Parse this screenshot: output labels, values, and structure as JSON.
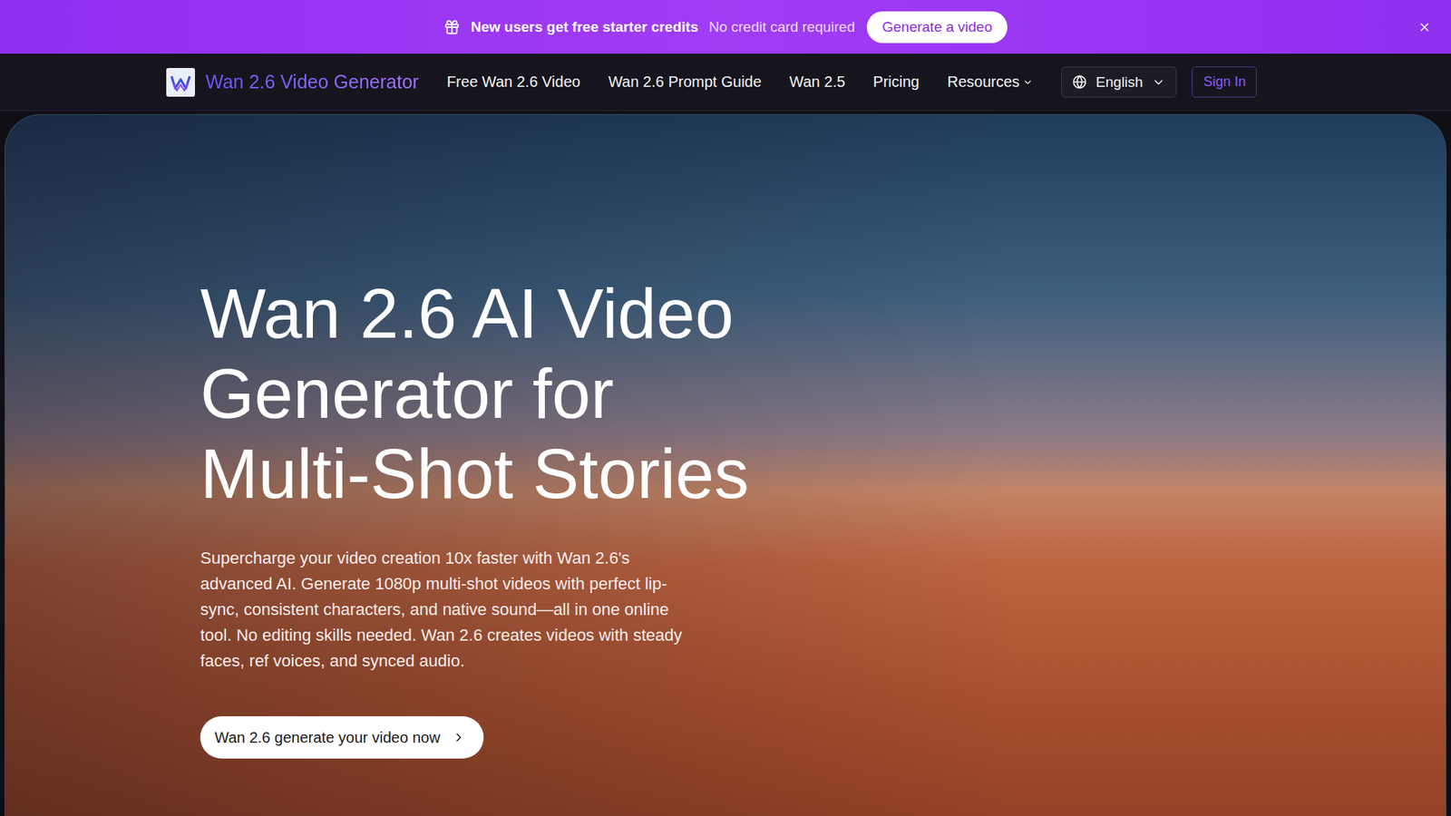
{
  "banner": {
    "title": "New users get free starter credits",
    "subtitle": "No credit card required",
    "button": "Generate a video"
  },
  "nav": {
    "brand": "Wan 2.6 Video Generator",
    "links": [
      {
        "label": "Free Wan 2.6 Video",
        "dropdown": false
      },
      {
        "label": "Wan 2.6 Prompt Guide",
        "dropdown": false
      },
      {
        "label": "Wan 2.5",
        "dropdown": false
      },
      {
        "label": "Pricing",
        "dropdown": false
      },
      {
        "label": "Resources",
        "dropdown": true
      }
    ],
    "language": "English",
    "sign_in": "Sign In"
  },
  "hero": {
    "title_lines": [
      "Wan 2.6 AI Video",
      "Generator for",
      "Multi-Shot Stories"
    ],
    "description": "Supercharge your video creation 10x faster with Wan 2.6's advanced AI. Generate 1080p multi-shot videos with perfect lip-sync, consistent characters, and native sound—all in one online tool. No editing skills needed. Wan 2.6 creates videos with steady faces, ref voices, and synced audio.",
    "cta": "Wan 2.6 generate your video now"
  }
}
